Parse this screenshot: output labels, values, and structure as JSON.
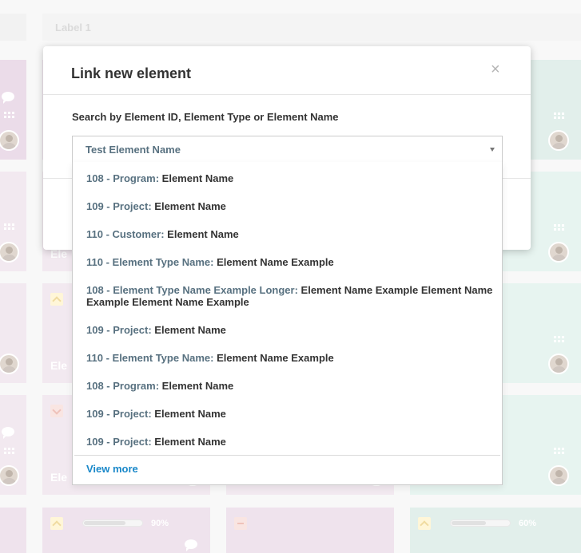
{
  "board": {
    "column_label": "Label 1",
    "cards": [
      {
        "progress_pct": "90%",
        "progress": 0.72
      },
      {
        "progress_pct": "60%",
        "progress": 0.6
      }
    ],
    "card_text": "Ele"
  },
  "modal": {
    "title": "Link new element",
    "close_symbol": "×",
    "search_label": "Search by Element ID, Element Type or Element Name",
    "select_value": "Test Element Name",
    "options": [
      {
        "prefix": "108 - Program:",
        "name": "Element Name"
      },
      {
        "prefix": "109 - Project:",
        "name": "Element Name"
      },
      {
        "prefix": "110 - Customer:",
        "name": "Element Name"
      },
      {
        "prefix": "110 - Element Type Name:",
        "name": "Element Name Example"
      },
      {
        "prefix": "108 - Element Type Name Example Longer:",
        "name": "Element Name Example Element Name Example Element Name Example"
      },
      {
        "prefix": "109 - Project:",
        "name": "Element Name"
      },
      {
        "prefix": "110 - Element Type Name:",
        "name": "Element Name Example"
      },
      {
        "prefix": "108 - Program:",
        "name": "Element Name"
      },
      {
        "prefix": "109 - Project:",
        "name": "Element Name"
      },
      {
        "prefix": "109 - Project:",
        "name": "Element Name"
      }
    ],
    "view_more": "View more"
  },
  "colors": {
    "accent_link": "#1a88c9",
    "prefix_text": "#587180"
  }
}
